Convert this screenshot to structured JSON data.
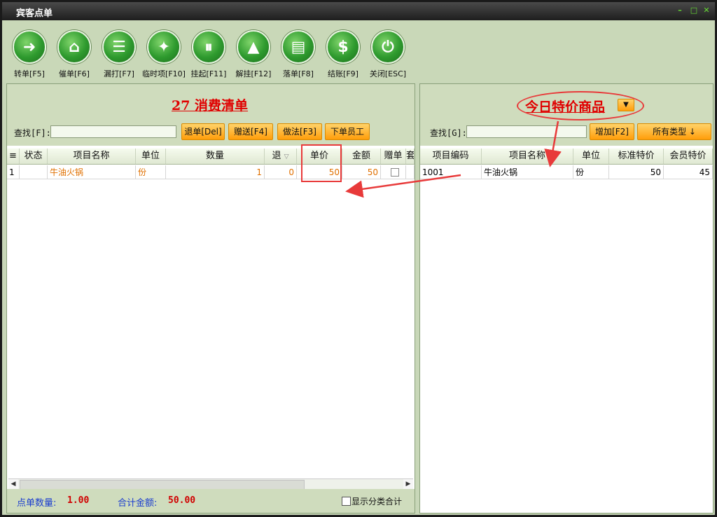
{
  "window": {
    "title": "宾客点单"
  },
  "toolbar": [
    {
      "label": "转单[F5]",
      "icon": "➜",
      "name": "transfer"
    },
    {
      "label": "催单[F6]",
      "icon": "⌂",
      "name": "urge"
    },
    {
      "label": "漏打[F7]",
      "icon": "☰",
      "name": "reprint"
    },
    {
      "label": "临时项[F10]",
      "icon": "✦",
      "name": "temp-item"
    },
    {
      "label": "挂起[F11]",
      "icon": "⏸",
      "name": "hold"
    },
    {
      "label": "解挂[F12]",
      "icon": "▲",
      "name": "unhold"
    },
    {
      "label": "落单[F8]",
      "icon": "▤",
      "name": "place-order"
    },
    {
      "label": "结账[F9]",
      "icon": "$",
      "name": "checkout"
    },
    {
      "label": "关闭[ESC]",
      "icon": "⏻",
      "name": "close"
    }
  ],
  "left": {
    "title": "27 消费清单",
    "search_label": "查找[F]:",
    "buttons": [
      "退单[Del]",
      "赠送[F4]",
      "做法[F3]",
      "下单员工"
    ],
    "columns": [
      "状态",
      "项目名称",
      "单位",
      "数量",
      "退",
      "单价",
      "金额",
      "赠单",
      "套"
    ],
    "rows": [
      {
        "idx": "1",
        "status": "",
        "name": "牛油火锅",
        "unit": "份",
        "qty": "1",
        "ret": "0",
        "price": "50",
        "amount": "50"
      }
    ],
    "footer": {
      "count_label": "点单数量:",
      "count": "1.00",
      "total_label": "合计金额:",
      "total": "50.00",
      "check_label": "显示分类合计"
    }
  },
  "right": {
    "title": "今日特价商品",
    "search_label": "查找[G]:",
    "add_button": "增加[F2]",
    "type_button": "所有类型 ↓",
    "columns": [
      "项目编码",
      "项目名称",
      "单位",
      "标准特价",
      "会员特价"
    ],
    "rows": [
      {
        "code": "1001",
        "name": "牛油火锅",
        "unit": "份",
        "std": "50",
        "member": "45"
      }
    ]
  },
  "colors": {
    "accent": "#e00000",
    "annotation": "#e83a3a",
    "button": "#ff9d0a"
  }
}
